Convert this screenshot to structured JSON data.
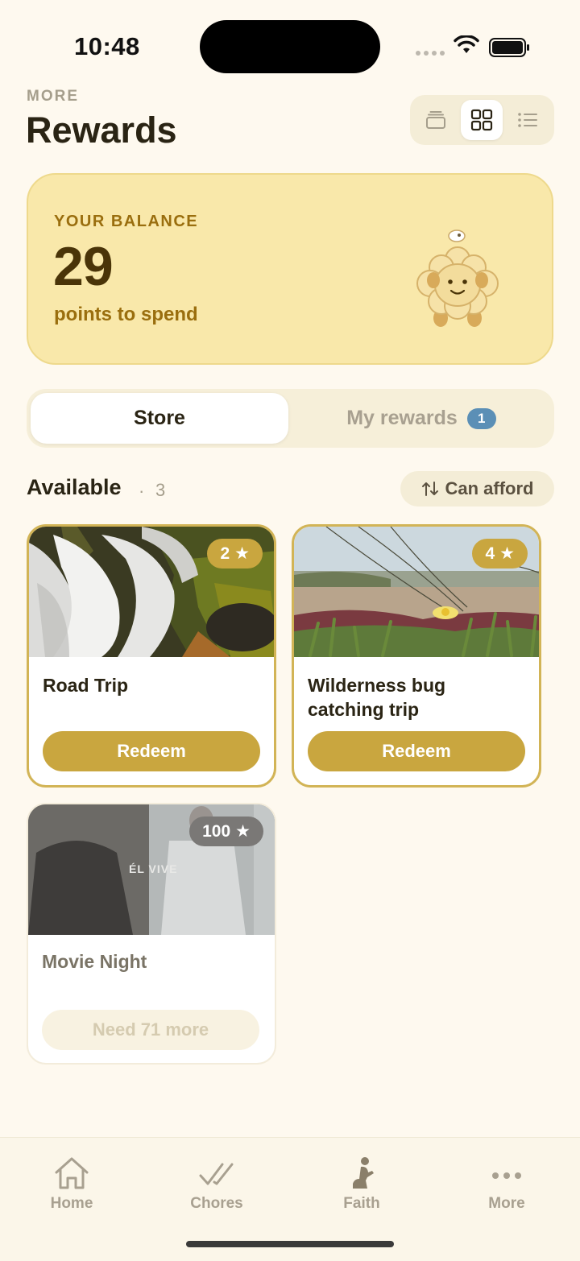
{
  "status_bar": {
    "time": "10:48"
  },
  "header": {
    "eyebrow": "MORE",
    "title": "Rewards"
  },
  "view_toggle": {
    "options": [
      "stack-view-icon",
      "grid-view-icon",
      "list-view-icon"
    ],
    "selected": "grid-view-icon"
  },
  "balance": {
    "label": "YOUR BALANCE",
    "value": "29",
    "subtitle": "points to spend"
  },
  "segments": {
    "store_label": "Store",
    "my_rewards_label": "My rewards",
    "my_rewards_badge": "1",
    "selected": "Store"
  },
  "available": {
    "title": "Available",
    "separator": "·",
    "count": "3",
    "sort_label": "Can afford"
  },
  "rewards": [
    {
      "name": "Road Trip",
      "price": "2",
      "button": "Redeem",
      "affordable": true
    },
    {
      "name": "Wilderness bug catching trip",
      "price": "4",
      "button": "Redeem",
      "affordable": true
    },
    {
      "name": "Movie Night",
      "price": "100",
      "button": "Need 71 more",
      "affordable": false,
      "image_text": "ÉL VIVE"
    }
  ],
  "tabbar": [
    {
      "label": "Home",
      "icon": "house-icon"
    },
    {
      "label": "Chores",
      "icon": "checkmarks-icon"
    },
    {
      "label": "Faith",
      "icon": "kneeling-prayer-icon"
    },
    {
      "label": "More",
      "icon": "ellipsis-icon"
    }
  ],
  "colors": {
    "background": "#FEF9EF",
    "accent": "#C9A63F",
    "balance_card": "#F9E8AA",
    "badge": "#5B8FB6"
  }
}
